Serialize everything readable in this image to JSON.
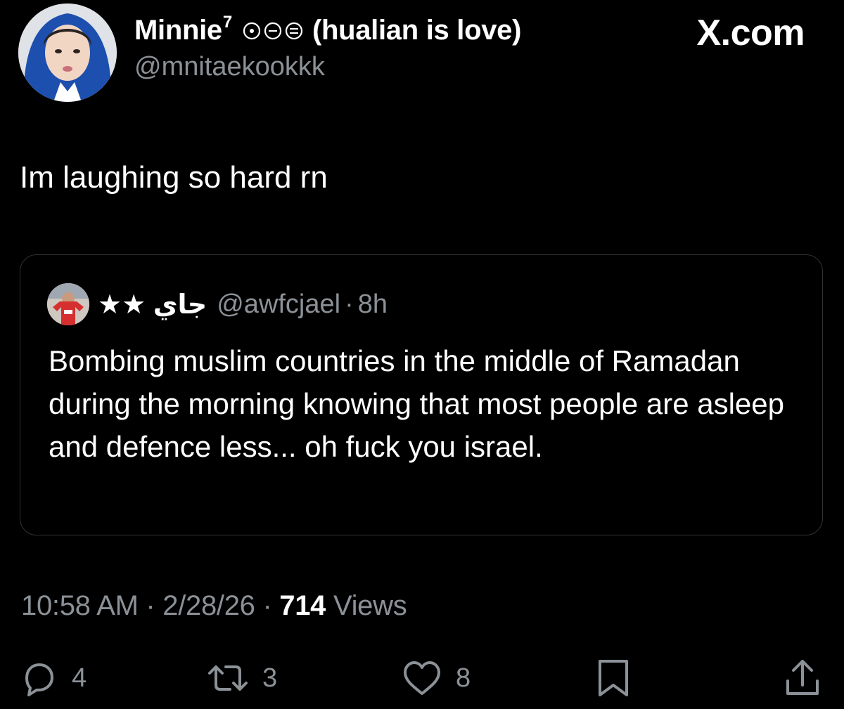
{
  "site": {
    "brand": "X.com"
  },
  "author": {
    "display_name": "Minnie",
    "superscript": "7",
    "name_suffix": "(hualian is love)",
    "handle": "@mnitaekookkk"
  },
  "tweet": {
    "text": "Im laughing so hard rn"
  },
  "quote": {
    "display_name": "★★ جاي",
    "handle": "@awfcjael",
    "separator": "·",
    "time": "8h",
    "text": "Bombing muslim countries in the middle of Ramadan during the morning knowing that most people are asleep and defence less... oh fuck you israel."
  },
  "meta": {
    "time": "10:58 AM",
    "separator1": " · ",
    "date": "2/28/26",
    "separator2": " · ",
    "views_count": "714",
    "views_label": " Views"
  },
  "actions": {
    "replies": "4",
    "reposts": "3",
    "likes": "8"
  },
  "colors": {
    "background": "#000000",
    "text_primary": "#ffffff",
    "text_secondary": "#8b9196",
    "border": "#2f3336"
  },
  "icons": [
    "reply-icon",
    "repost-icon",
    "like-icon",
    "bookmark-icon",
    "share-icon"
  ]
}
